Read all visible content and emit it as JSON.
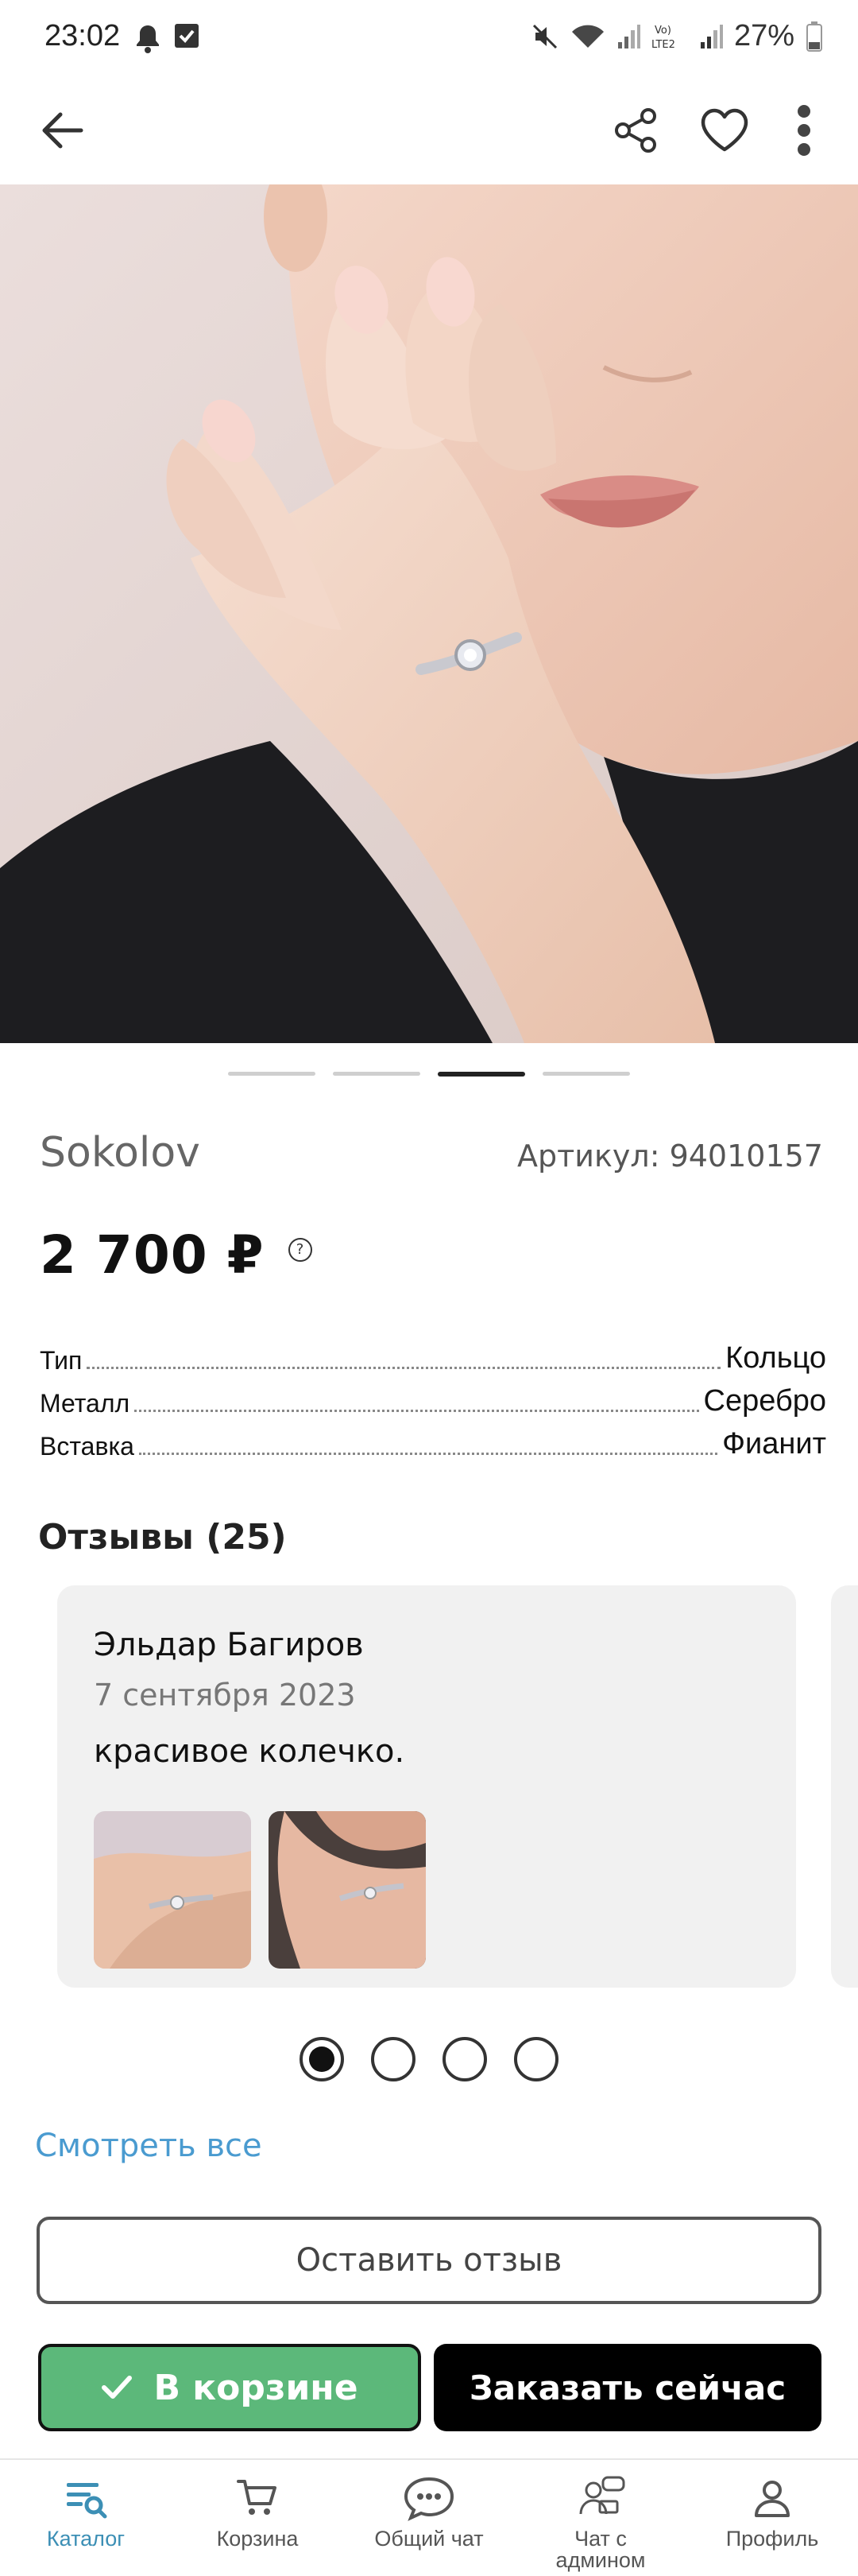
{
  "status_bar": {
    "time": "23:02",
    "battery": "27%"
  },
  "product": {
    "brand": "Sokolov",
    "article": "Артикул: 94010157",
    "price": "2 700 ₽",
    "price_help": "?",
    "image_dots": 4,
    "image_active": 2,
    "specs": [
      {
        "key": "Тип",
        "value": "Кольцо"
      },
      {
        "key": "Металл",
        "value": "Серебро"
      },
      {
        "key": "Вставка",
        "value": "Фианит"
      }
    ]
  },
  "reviews": {
    "title": "Отзывы (25)",
    "items": [
      {
        "author": "Эльдар Багиров",
        "date": "7 сентября 2023",
        "text": "красивое колечко."
      }
    ],
    "pager_count": 4,
    "pager_active": 0,
    "see_all": "Смотреть все",
    "leave_review": "Оставить отзыв"
  },
  "actions": {
    "in_cart": "В корзине",
    "order_now": "Заказать сейчас"
  },
  "bottom_nav": [
    {
      "label": "Каталог",
      "icon": "catalog-icon",
      "active": true
    },
    {
      "label": "Корзина",
      "icon": "cart-icon",
      "active": false
    },
    {
      "label": "Общий чат",
      "icon": "chat-icon",
      "active": false
    },
    {
      "label": "Чат с админом",
      "icon": "admin-chat-icon",
      "active": false
    },
    {
      "label": "Профиль",
      "icon": "profile-icon",
      "active": false
    }
  ],
  "colors": {
    "accent_green": "#5cb87a",
    "link_blue": "#4a9bd0",
    "nav_active": "#3c8fb5"
  }
}
